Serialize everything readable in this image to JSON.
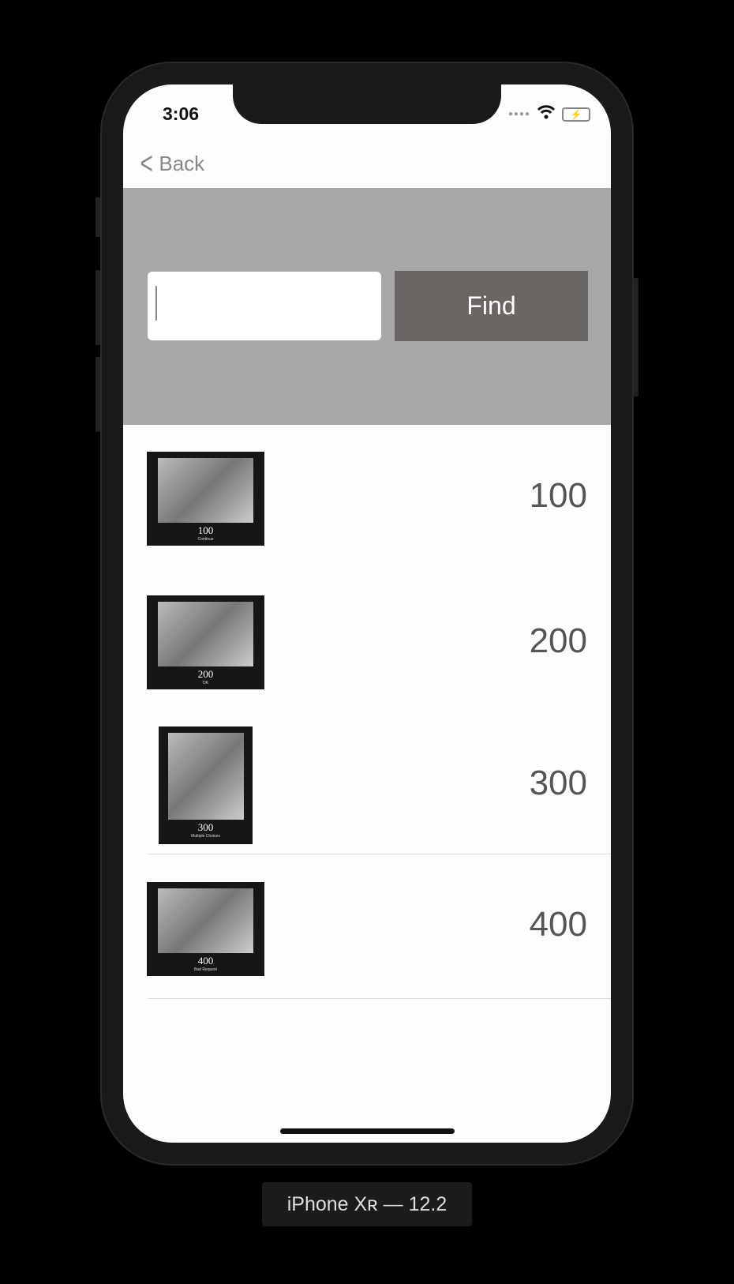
{
  "status_bar": {
    "time": "3:06",
    "signal": "●●●●",
    "battery": "⚡"
  },
  "nav": {
    "back_label": "Back"
  },
  "search": {
    "value": "",
    "placeholder": "",
    "find_label": "Find"
  },
  "items": [
    {
      "code": "100",
      "caption": "Continue",
      "value": "100"
    },
    {
      "code": "200",
      "caption": "OK",
      "value": "200"
    },
    {
      "code": "300",
      "caption": "Multiple Choices",
      "value": "300"
    },
    {
      "code": "400",
      "caption": "Bad Request",
      "value": "400"
    }
  ],
  "device_label": "iPhone Xʀ — 12.2"
}
